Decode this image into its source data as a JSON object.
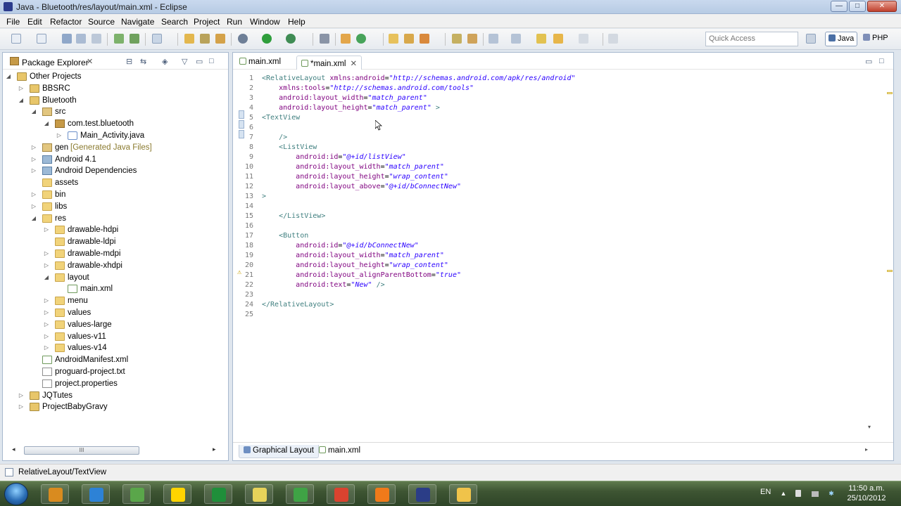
{
  "window": {
    "title": "Java - Bluetooth/res/layout/main.xml - Eclipse",
    "minimize": "—",
    "maximize": "□",
    "close": "✕"
  },
  "menu": [
    "File",
    "Edit",
    "Refactor",
    "Source",
    "Navigate",
    "Search",
    "Project",
    "Run",
    "Window",
    "Help"
  ],
  "toolbar": {
    "quick_access_placeholder": "Quick Access",
    "perspectives": [
      "Java",
      "PHP"
    ]
  },
  "package_explorer": {
    "title": "Package Explorer",
    "tree": [
      {
        "label": "Other Projects",
        "indent": 0,
        "expanded": true,
        "icon": "working-set-icon"
      },
      {
        "label": "BBSRC",
        "indent": 1,
        "expanded": false,
        "icon": "project-icon"
      },
      {
        "label": "Bluetooth",
        "indent": 1,
        "expanded": true,
        "icon": "android-project-icon"
      },
      {
        "label": "src",
        "indent": 2,
        "expanded": true,
        "icon": "source-folder-icon"
      },
      {
        "label": "com.test.bluetooth",
        "indent": 3,
        "expanded": true,
        "icon": "package-icon"
      },
      {
        "label": "Main_Activity.java",
        "indent": 4,
        "expanded": false,
        "icon": "java-file-icon"
      },
      {
        "label": "gen",
        "suffix": "[Generated Java Files]",
        "indent": 2,
        "expanded": false,
        "icon": "source-folder-icon"
      },
      {
        "label": "Android 4.1",
        "indent": 2,
        "expanded": false,
        "icon": "library-icon"
      },
      {
        "label": "Android Dependencies",
        "indent": 2,
        "expanded": false,
        "icon": "library-icon"
      },
      {
        "label": "assets",
        "indent": 2,
        "expanded": null,
        "icon": "folder-icon"
      },
      {
        "label": "bin",
        "indent": 2,
        "expanded": false,
        "icon": "folder-icon"
      },
      {
        "label": "libs",
        "indent": 2,
        "expanded": false,
        "icon": "folder-icon"
      },
      {
        "label": "res",
        "indent": 2,
        "expanded": true,
        "icon": "folder-icon"
      },
      {
        "label": "drawable-hdpi",
        "indent": 3,
        "expanded": false,
        "icon": "folder-icon"
      },
      {
        "label": "drawable-ldpi",
        "indent": 3,
        "expanded": null,
        "icon": "folder-icon"
      },
      {
        "label": "drawable-mdpi",
        "indent": 3,
        "expanded": false,
        "icon": "folder-icon"
      },
      {
        "label": "drawable-xhdpi",
        "indent": 3,
        "expanded": false,
        "icon": "folder-icon"
      },
      {
        "label": "layout",
        "indent": 3,
        "expanded": true,
        "icon": "folder-icon"
      },
      {
        "label": "main.xml",
        "indent": 4,
        "expanded": null,
        "icon": "xml-file-icon"
      },
      {
        "label": "menu",
        "indent": 3,
        "expanded": false,
        "icon": "folder-icon"
      },
      {
        "label": "values",
        "indent": 3,
        "expanded": false,
        "icon": "folder-icon"
      },
      {
        "label": "values-large",
        "indent": 3,
        "expanded": false,
        "icon": "folder-icon"
      },
      {
        "label": "values-v11",
        "indent": 3,
        "expanded": false,
        "icon": "folder-icon"
      },
      {
        "label": "values-v14",
        "indent": 3,
        "expanded": false,
        "icon": "folder-icon"
      },
      {
        "label": "AndroidManifest.xml",
        "indent": 2,
        "expanded": null,
        "icon": "xml-file-icon"
      },
      {
        "label": "proguard-project.txt",
        "indent": 2,
        "expanded": null,
        "icon": "text-file-icon"
      },
      {
        "label": "project.properties",
        "indent": 2,
        "expanded": null,
        "icon": "text-file-icon"
      },
      {
        "label": "JQTutes",
        "indent": 1,
        "expanded": false,
        "icon": "project-icon"
      },
      {
        "label": "ProjectBabyGravy",
        "indent": 1,
        "expanded": false,
        "icon": "project-icon"
      }
    ],
    "scroll_grip": "III"
  },
  "editor": {
    "tabs": [
      {
        "label": "main.xml",
        "active": false
      },
      {
        "label": "*main.xml",
        "active": true
      }
    ],
    "lines": [
      {
        "n": "1",
        "text": "<RelativeLayout xmlns:android=\"http://schemas.android.com/apk/res/android\""
      },
      {
        "n": "2",
        "text": "    xmlns:tools=\"http://schemas.android.com/tools\""
      },
      {
        "n": "3",
        "text": "    android:layout_width=\"match_parent\""
      },
      {
        "n": "4",
        "text": "    android:layout_height=\"match_parent\" >"
      },
      {
        "n": "5",
        "text": "<TextView"
      },
      {
        "n": "6",
        "text": ""
      },
      {
        "n": "7",
        "text": "    />"
      },
      {
        "n": "8",
        "text": "    <ListView"
      },
      {
        "n": "9",
        "text": "        android:id=\"@+id/listView\""
      },
      {
        "n": "10",
        "text": "        android:layout_width=\"match_parent\""
      },
      {
        "n": "11",
        "text": "        android:layout_height=\"wrap_content\""
      },
      {
        "n": "12",
        "text": "        android:layout_above=\"@+id/bConnectNew\""
      },
      {
        "n": "13",
        "text": ">"
      },
      {
        "n": "14",
        "text": ""
      },
      {
        "n": "15",
        "text": "    </ListView>"
      },
      {
        "n": "16",
        "text": ""
      },
      {
        "n": "17",
        "text": "    <Button"
      },
      {
        "n": "18",
        "text": "        android:id=\"@+id/bConnectNew\""
      },
      {
        "n": "19",
        "text": "        android:layout_width=\"match_parent\""
      },
      {
        "n": "20",
        "text": "        android:layout_height=\"wrap_content\""
      },
      {
        "n": "21",
        "text": "        android:layout_alignParentBottom=\"true\""
      },
      {
        "n": "22",
        "text": "        android:text=\"New\" />"
      },
      {
        "n": "23",
        "text": ""
      },
      {
        "n": "24",
        "text": "</RelativeLayout>"
      },
      {
        "n": "25",
        "text": ""
      }
    ],
    "bottom_tabs": [
      {
        "label": "Graphical Layout",
        "active": true
      },
      {
        "label": "main.xml",
        "active": false
      }
    ]
  },
  "status": {
    "text": "RelativeLayout/TextView"
  },
  "taskbar": {
    "language": "EN",
    "time": "11:50 a.m.",
    "date": "25/10/2012",
    "apps": [
      {
        "icon": "media-player-icon",
        "color": "#d98b1f"
      },
      {
        "icon": "teamviewer-icon",
        "color": "#2d82d6"
      },
      {
        "icon": "evernote-icon",
        "color": "#5aa64a"
      },
      {
        "icon": "movie-maker-icon",
        "color": "#ffd400"
      },
      {
        "icon": "csharp-icon",
        "color": "#1f8f3a"
      },
      {
        "icon": "notes-icon",
        "color": "#e6d35a"
      },
      {
        "icon": "chart-app-icon",
        "color": "#3fa345"
      },
      {
        "icon": "chrome-icon",
        "color": "#d9432f"
      },
      {
        "icon": "xampp-icon",
        "color": "#f07a1a"
      },
      {
        "icon": "eclipse-icon",
        "color": "#2b3d87"
      },
      {
        "icon": "explorer-icon",
        "color": "#f0c34a"
      }
    ]
  },
  "colors": {
    "xml_tag": "#3f7f7f",
    "xml_attr": "#7f007f",
    "xml_value": "#2a00ff",
    "line_number": "#787878"
  }
}
